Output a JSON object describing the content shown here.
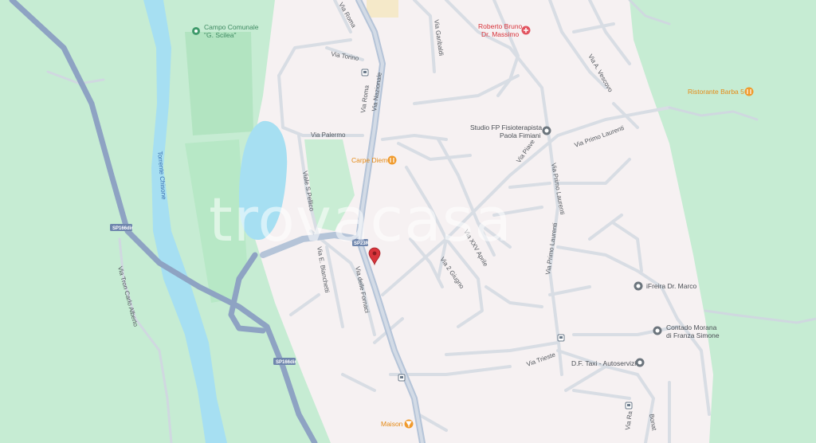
{
  "map": {
    "watermark": "trovacasa",
    "colors": {
      "land": "#f6f1f2",
      "park": "#c6ecd3",
      "water": "#a6dff2",
      "road_minor": "#d8dde4",
      "road_major": "#b5c4d8",
      "highway": "#8ea3c3",
      "pin": "#d8343b"
    },
    "road_labels": [
      {
        "id": "via-roma",
        "text": "Via Roma"
      },
      {
        "id": "via-nazionale",
        "text": "Via Nazionale"
      },
      {
        "id": "via-torino",
        "text": "Via Torino"
      },
      {
        "id": "via-palermo",
        "text": "Via Palermo"
      },
      {
        "id": "viale-pellico",
        "text": "Viale S.Pellico"
      },
      {
        "id": "via-gasparri",
        "text": "Via E. Bianchetti"
      },
      {
        "id": "via-fornaci",
        "text": "Via delle Fornaci"
      },
      {
        "id": "via-piave",
        "text": "Via Piave"
      },
      {
        "id": "via-xxv-aprile",
        "text": "Via XXV Aprile"
      },
      {
        "id": "via-4-giugno",
        "text": "Via 2 Giugno"
      },
      {
        "id": "via-primo-laurenti-1",
        "text": "Via Primo Laurenti"
      },
      {
        "id": "via-primo-laurenti-2",
        "text": "Via Primo Laurenti"
      },
      {
        "id": "via-primo-laurenti-3",
        "text": "Via Primo Laurenti"
      },
      {
        "id": "via-trieste",
        "text": "Via Trieste"
      },
      {
        "id": "via-vescovo",
        "text": "Via A. Vescovo"
      },
      {
        "id": "via-roma-top",
        "text": "Via Roma"
      },
      {
        "id": "via-garibaldi",
        "text": "Via Garibaldi"
      },
      {
        "id": "via-tron",
        "text": "Via Tron Carlo Alberto"
      },
      {
        "id": "via-bottom",
        "text": "Via Ra"
      },
      {
        "id": "via-bonat",
        "text": "Bonat"
      },
      {
        "id": "torrente",
        "text": "Torrente Chisone"
      }
    ],
    "shields": [
      {
        "id": "sp166a-1",
        "text": "SP166dir"
      },
      {
        "id": "sp166a-2",
        "text": "SP166dir"
      },
      {
        "id": "sp23",
        "text": "SP23R"
      }
    ],
    "pois": [
      {
        "id": "campo",
        "line1": "Campo Comunale",
        "line2": "\"G. Scilea\"",
        "icon": "park-pin-icon"
      },
      {
        "id": "roberto-bruno",
        "line1": "Roberto Bruno",
        "line2": "Dr. Massimo",
        "icon": "medical-pin-icon"
      },
      {
        "id": "barba",
        "line1": "Ristorante Barba 5",
        "line2": "",
        "icon": "restaurant-pin-icon"
      },
      {
        "id": "studio-fp",
        "line1": "Studio FP Fisioterapista",
        "line2": "Paola Fimiani",
        "icon": "shop-pin-icon"
      },
      {
        "id": "carpe-diem",
        "line1": "Carpe Diem",
        "line2": "",
        "icon": "restaurant-pin-icon"
      },
      {
        "id": "ifreira",
        "line1": "iFreira Dr. Marco",
        "line2": "",
        "icon": "shop-pin-icon"
      },
      {
        "id": "contado",
        "line1": "Contado Morana",
        "line2": "di Franza Simone",
        "icon": "shop-pin-icon"
      },
      {
        "id": "df-taxi",
        "line1": "D.F. Taxi - Autoservizi",
        "line2": "",
        "icon": "shop-pin-icon"
      },
      {
        "id": "maison",
        "line1": "Maison",
        "line2": "",
        "icon": "bar-pin-icon"
      }
    ]
  }
}
